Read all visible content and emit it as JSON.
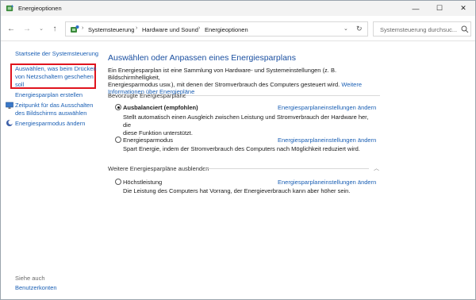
{
  "window": {
    "title": "Energieoptionen",
    "controls": {
      "minimize": "—",
      "maximize": "☐",
      "close": "✕"
    }
  },
  "nav": {
    "back": "←",
    "forward": "→",
    "history": "⌄",
    "up": "↑"
  },
  "address": {
    "separator": "›",
    "crumbs": [
      "Systemsteuerung",
      "Hardware und Sound",
      "Energieoptionen"
    ],
    "dropdown": "⌄",
    "refresh": "↻"
  },
  "search": {
    "placeholder": "Systemsteuerung durchsuc..."
  },
  "sidebar": {
    "home": "Startseite der Systemsteuerung",
    "items": [
      {
        "line1": "Auswählen, was beim Drücken",
        "line2": "von Netzschaltern geschehen",
        "line3": "soll"
      },
      {
        "line1": "Energiesparplan erstellen"
      },
      {
        "line1": "Zeitpunkt für das Ausschalten",
        "line2": "des Bildschirms auswählen"
      },
      {
        "line1": "Energiesparmodus ändern"
      }
    ],
    "see_also": "Siehe auch",
    "user_accounts": "Benutzerkonten"
  },
  "main": {
    "title": "Auswählen oder Anpassen eines Energiesparplans",
    "intro_line1": "Ein Energiesparplan ist eine Sammlung von Hardware- und Systemeinstellungen (z. B. Bildschirmhelligkeit,",
    "intro_line2": "Energiesparmodus usw.), mit denen der Stromverbrauch des Computers gesteuert wird.",
    "intro_link_a": "Weitere",
    "intro_link_b": "Informationen über Energiepläne",
    "preferred_label": "Bevorzugte Energiesparpläne",
    "plans": [
      {
        "name": "Ausbalanciert (empfohlen)",
        "selected": true,
        "link": "Energiesparplaneinstellungen ändern",
        "desc1": "Stellt automatisch einen Ausgleich zwischen Leistung und Stromverbrauch der Hardware her, die",
        "desc2": "diese Funktion unterstützt."
      },
      {
        "name": "Energiesparmodus",
        "selected": false,
        "link": "Energiesparplaneinstellungen ändern",
        "desc1": "Spart Energie, indem der Stromverbrauch des Computers nach Möglichkeit reduziert wird."
      }
    ],
    "hide_label": "Weitere Energiesparpläne ausblenden",
    "collapse": "︿",
    "more_plans": [
      {
        "name": "Höchstleistung",
        "selected": false,
        "link": "Energiesparplaneinstellungen ändern",
        "desc1": "Die Leistung des Computers hat Vorrang, der Energieverbrauch kann aber höher sein."
      }
    ]
  },
  "colors": {
    "link": "#1a5fb4",
    "title": "#1a4fa0",
    "highlight": "#e0141e"
  }
}
